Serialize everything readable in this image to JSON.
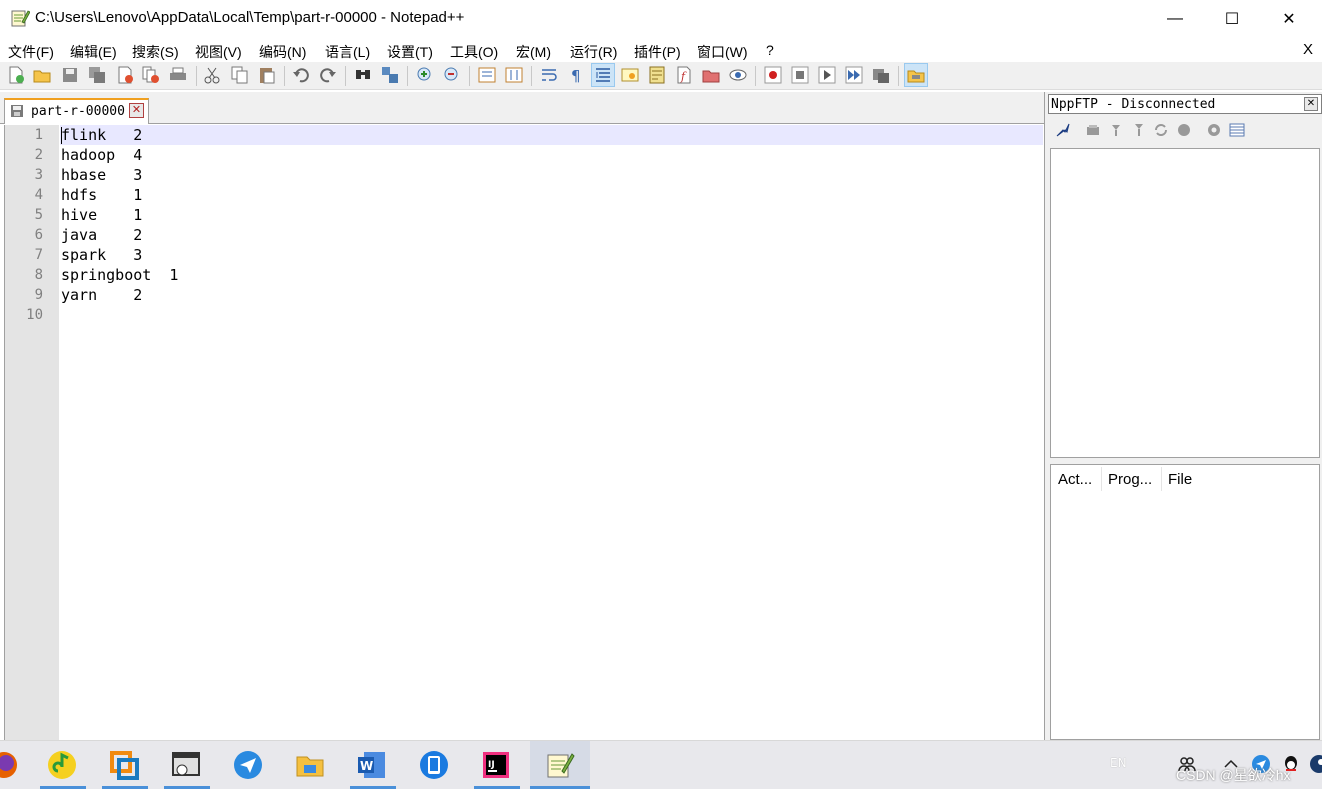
{
  "window": {
    "title": "C:\\Users\\Lenovo\\AppData\\Local\\Temp\\part-r-00000 - Notepad++",
    "minimize_glyph": "—",
    "maximize_glyph": "☐",
    "close_glyph": "✕"
  },
  "menu": {
    "items": [
      "文件(F)",
      "编辑(E)",
      "搜索(S)",
      "视图(V)",
      "编码(N)",
      "语言(L)",
      "设置(T)",
      "工具(O)",
      "宏(M)",
      "运行(R)",
      "插件(P)",
      "窗口(W)",
      "?"
    ],
    "close_label": "X"
  },
  "toolbar": {
    "icons": [
      "new-file-icon",
      "open-file-icon",
      "save-icon",
      "save-all-icon",
      "close-icon",
      "close-all-icon",
      "print-icon",
      "cut-icon",
      "copy-icon",
      "paste-icon",
      "undo-icon",
      "redo-icon",
      "find-icon",
      "replace-icon",
      "zoom-in-icon",
      "zoom-out-icon",
      "sync-vertical-icon",
      "sync-horizontal-icon",
      "word-wrap-icon",
      "show-all-chars-icon",
      "indent-guide-icon",
      "user-language-icon",
      "document-map-icon",
      "function-list-icon",
      "folder-workspace-icon",
      "monitoring-icon",
      "record-macro-icon",
      "stop-macro-icon",
      "play-macro-icon",
      "run-macro-multiple-icon",
      "save-macro-icon",
      "nppftp-icon"
    ]
  },
  "tabs": [
    {
      "label": "part-r-00000",
      "close": "✕"
    }
  ],
  "editor": {
    "line_numbers": [
      "1",
      "2",
      "3",
      "4",
      "5",
      "6",
      "7",
      "8",
      "9",
      "10"
    ],
    "lines": [
      "flink   2",
      "hadoop  4",
      "hbase   3",
      "hdfs    1",
      "hive    1",
      "java    2",
      "spark   3",
      "springboot  1",
      "yarn    2",
      ""
    ],
    "current_line": 1
  },
  "ftp_panel": {
    "title": "NppFTP - Disconnected",
    "close": "✕",
    "queue_columns": [
      "Act...",
      "Prog...",
      "File"
    ]
  },
  "taskbar": {
    "apps": [
      "firefox-icon",
      "qq-music-icon",
      "vmware-icon",
      "remote-desktop-icon",
      "feishu-icon",
      "file-explorer-icon",
      "word-icon",
      "tablet-icon",
      "intellij-icon",
      "notepadpp-icon"
    ],
    "tray": {
      "language": "EN",
      "watermark": "CSDN @星欲冷hx"
    }
  }
}
